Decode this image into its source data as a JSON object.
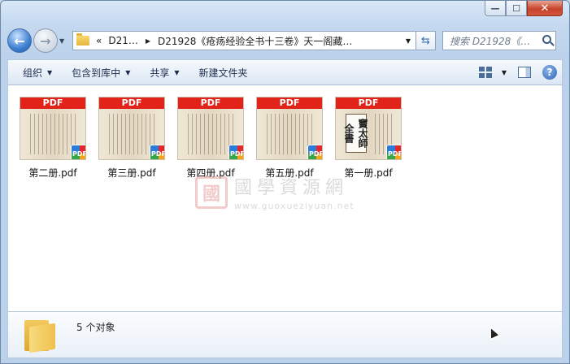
{
  "window": {
    "minimize_glyph": "—",
    "maximize_glyph": "☐",
    "close_glyph": "✕"
  },
  "nav": {
    "back_glyph": "←",
    "forward_glyph": "→",
    "breadcrumb": [
      {
        "label": "«"
      },
      {
        "label": "D21…"
      },
      {
        "label": "D21928《疮疡经验全书十三卷》天一阁藏…"
      }
    ],
    "search_placeholder": "搜索 D21928《…"
  },
  "toolbar": {
    "organize": "组织",
    "include_library": "包含到库中",
    "share": "共享",
    "new_folder": "新建文件夹"
  },
  "files": [
    {
      "name": "第二册.pdf",
      "band": "PDF",
      "badge": "PDF"
    },
    {
      "name": "第三册.pdf",
      "band": "PDF",
      "badge": "PDF"
    },
    {
      "name": "第四册.pdf",
      "band": "PDF",
      "badge": "PDF"
    },
    {
      "name": "第五册.pdf",
      "band": "PDF",
      "badge": "PDF"
    },
    {
      "name": "第一册.pdf",
      "band": "PDF",
      "badge": "PDF",
      "cover_text": "竇太師全書"
    }
  ],
  "watermark": {
    "seal": "國",
    "text": "國學資源網",
    "url": "www.guoxueziyuan.net"
  },
  "status": {
    "count_text": "5 个对象"
  }
}
